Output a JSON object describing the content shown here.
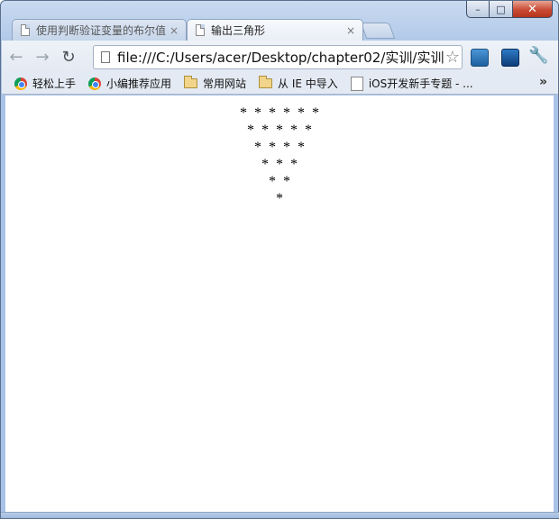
{
  "window": {
    "caption": {
      "minimize_label": "–",
      "maximize_label": "□",
      "close_label": "✕"
    }
  },
  "tabs": [
    {
      "title": "使用判断验证变量的布尔值",
      "close": "×"
    },
    {
      "title": "输出三角形",
      "close": "×"
    }
  ],
  "toolbar": {
    "back_icon": "←",
    "forward_icon": "→",
    "reload_icon": "↻",
    "url": "file:///C:/Users/acer/Desktop/chapter02/实训/实训",
    "star_icon": "☆",
    "wrench_icon": "🔧"
  },
  "bookmarks": [
    {
      "label": "轻松上手",
      "icon": "chrome-icon"
    },
    {
      "label": "小编推荐应用",
      "icon": "chrome-icon"
    },
    {
      "label": "常用网站",
      "icon": "folder-icon"
    },
    {
      "label": "从 IE 中导入",
      "icon": "folder-icon"
    },
    {
      "label": "iOS开发新手专题 - ...",
      "icon": "ios-page-icon"
    }
  ],
  "bookmarks_more": "»",
  "page": {
    "rows": [
      "*  *  *  *  *  *",
      "*  *  *  *  *",
      "*  *  *  *",
      "*  *  *",
      "*  *",
      "*"
    ]
  }
}
